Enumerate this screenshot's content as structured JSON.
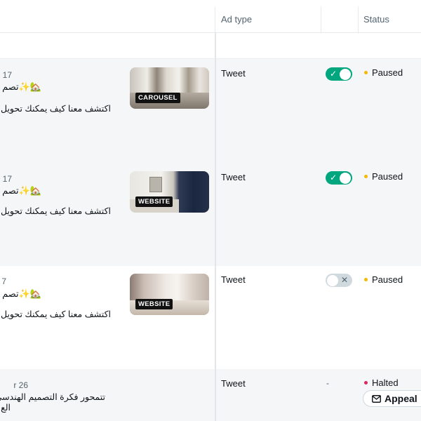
{
  "header": {
    "ad_type_label": "Ad type",
    "status_label": "Status"
  },
  "rows": [
    {
      "date": "17",
      "title": "تصم✨🏡",
      "description": "اكتشف معنا كيف يمكنك تحويل",
      "media_tag": "CAROUSEL",
      "ad_type": "Tweet",
      "toggle": "on",
      "status": "Paused"
    },
    {
      "date": "17",
      "title": "تصم✨🏡",
      "description": "اكتشف معنا كيف يمكنك تحويل",
      "media_tag": "WEBSITE",
      "ad_type": "Tweet",
      "toggle": "on",
      "status": "Paused"
    },
    {
      "date": "7",
      "title": "تصم✨🏡",
      "description": "اكتشف معنا كيف يمكنك تحويل",
      "media_tag": "WEBSITE",
      "ad_type": "Tweet",
      "toggle": "off",
      "status": "Paused"
    },
    {
      "date": "r 26",
      "description_line1": "تتمحور فكرة التصميم الهندسي",
      "description_line2": "الع",
      "ad_type": "Tweet",
      "toggle_placeholder": "-",
      "status": "Halted",
      "action_label": "Appeal"
    }
  ],
  "colors": {
    "toggle_on": "#00a67e",
    "toggle_off": "#cfd9de",
    "paused_dot": "#f5b800",
    "halted_dot": "#e0245e"
  }
}
